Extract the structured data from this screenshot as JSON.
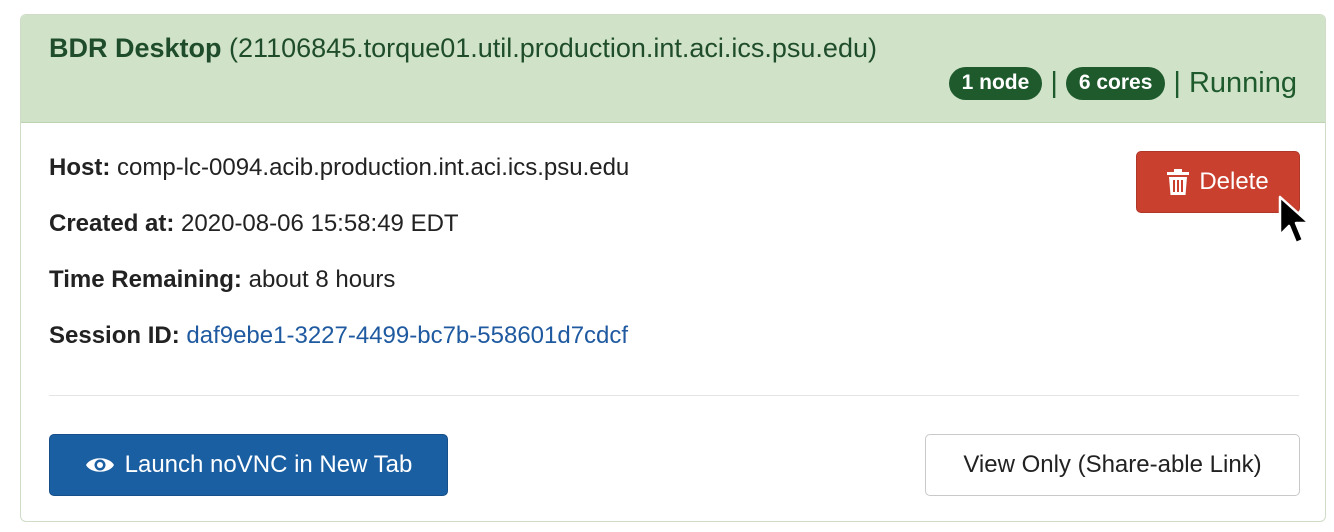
{
  "session": {
    "app_name": "BDR Desktop",
    "job_id": "(21106845.torque01.util.production.int.aci.ics.psu.edu)",
    "nodes_badge": "1 node",
    "cores_badge": "6 cores",
    "separator": "|",
    "status": "Running"
  },
  "details": {
    "host_label": "Host:",
    "host_value": "comp-lc-0094.acib.production.int.aci.ics.psu.edu",
    "created_label": "Created at:",
    "created_value": "2020-08-06 15:58:49 EDT",
    "remaining_label": "Time Remaining:",
    "remaining_value": "about 8 hours",
    "session_label": "Session ID:",
    "session_value": "daf9ebe1-3227-4499-bc7b-558601d7cdcf"
  },
  "actions": {
    "delete_label": "Delete",
    "delete_icon": "trash-icon",
    "launch_label": "Launch noVNC in New Tab",
    "launch_icon": "eye-icon",
    "view_only_label": "View Only (Share-able Link)"
  },
  "colors": {
    "header_bg": "#d0e3c9",
    "badge_bg": "#1e5a2c",
    "delete_bg": "#c9402f",
    "launch_bg": "#1b5fa3",
    "link": "#1f5aa0"
  }
}
